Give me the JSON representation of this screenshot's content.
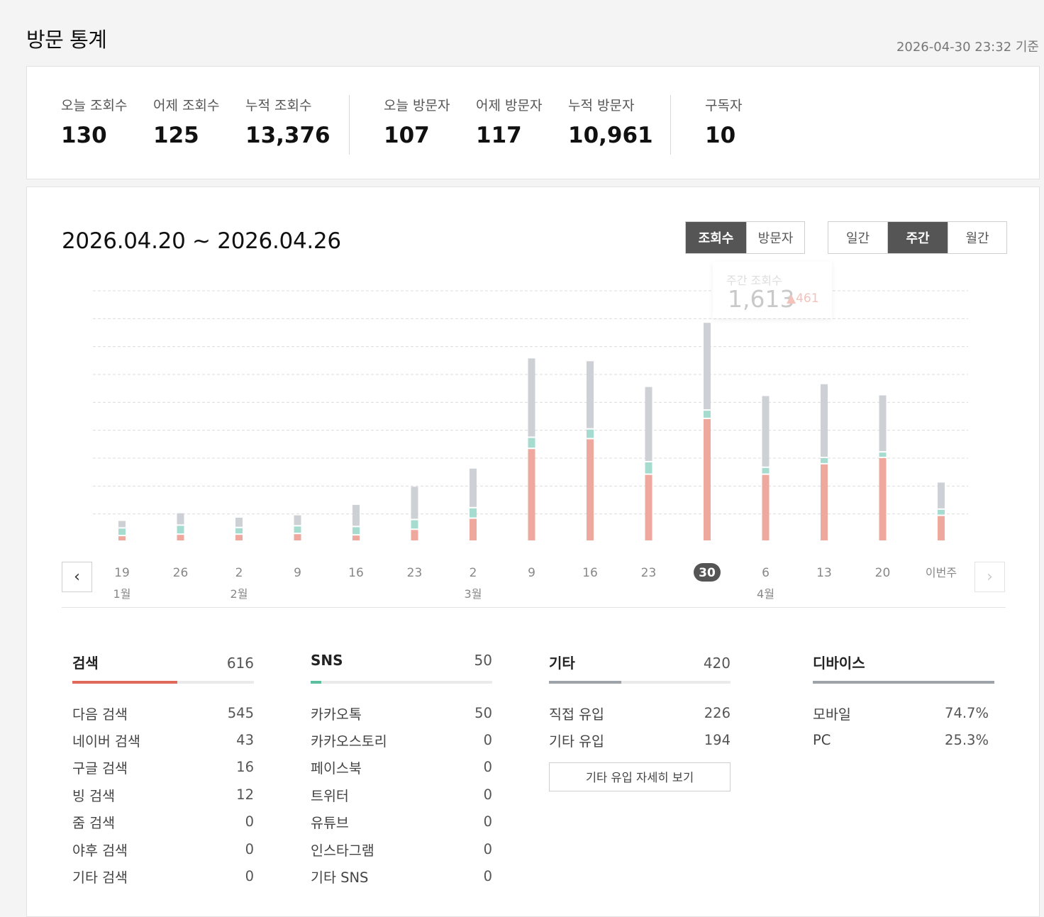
{
  "header": {
    "title": "방문 통계",
    "as_of": "2026-04-30 23:32 기준"
  },
  "summary": {
    "stats": [
      {
        "label": "오늘 조회수",
        "value": "130"
      },
      {
        "label": "어제 조회수",
        "value": "125"
      },
      {
        "label": "누적 조회수",
        "value": "13,376"
      },
      {
        "label": "오늘 방문자",
        "value": "107"
      },
      {
        "label": "어제 방문자",
        "value": "117"
      },
      {
        "label": "누적 방문자",
        "value": "10,961"
      },
      {
        "label": "구독자",
        "value": "10"
      }
    ]
  },
  "chart_panel": {
    "range_title": "2026.04.20 ~ 2026.04.26",
    "metric_toggle": [
      "조회수",
      "방문자"
    ],
    "metric_selected": "조회수",
    "period_toggle": [
      "일간",
      "주간",
      "월간"
    ],
    "period_selected": "주간",
    "tooltip": {
      "label": "주간 조회수",
      "value": "1,613",
      "delta": "▲461"
    },
    "prev_icon": "chevron-left-icon",
    "next_icon": "chevron-right-icon"
  },
  "chart_data": {
    "type": "bar",
    "stacked": true,
    "categories": [
      "19",
      "26",
      "2",
      "9",
      "16",
      "23",
      "2",
      "9",
      "16",
      "23",
      "30",
      "6",
      "13",
      "20",
      "이번주"
    ],
    "month_labels": [
      "1월",
      "",
      "2월",
      "",
      "",
      "",
      "3월",
      "",
      "",
      "",
      "",
      "4월",
      "",
      "",
      ""
    ],
    "selected_category_index": 10,
    "ylim": [
      0,
      1800
    ],
    "grid": true,
    "series": [
      {
        "color": "#eea89e",
        "values": [
          40,
          50,
          50,
          55,
          45,
          85,
          165,
          665,
          735,
          480,
          880,
          480,
          555,
          600,
          185
        ]
      },
      {
        "color": "#a6dccf",
        "values": [
          55,
          65,
          48,
          55,
          60,
          70,
          75,
          80,
          70,
          90,
          60,
          50,
          45,
          40,
          45
        ]
      },
      {
        "color": "#cdd0d5",
        "values": [
          55,
          90,
          75,
          80,
          160,
          240,
          285,
          570,
          490,
          540,
          630,
          515,
          530,
          410,
          195
        ]
      }
    ]
  },
  "breakdown": {
    "search": {
      "title": "검색",
      "total": "616",
      "fill": 0.58,
      "color": "#e06a5a",
      "rows": [
        {
          "label": "다음 검색",
          "value": "545"
        },
        {
          "label": "네이버 검색",
          "value": "43"
        },
        {
          "label": "구글 검색",
          "value": "16"
        },
        {
          "label": "빙 검색",
          "value": "12"
        },
        {
          "label": "줌 검색",
          "value": "0"
        },
        {
          "label": "야후 검색",
          "value": "0"
        },
        {
          "label": "기타 검색",
          "value": "0"
        }
      ]
    },
    "sns": {
      "title": "SNS",
      "total": "50",
      "fill": 0.06,
      "color": "#5bbf9f",
      "rows": [
        {
          "label": "카카오톡",
          "value": "50"
        },
        {
          "label": "카카오스토리",
          "value": "0"
        },
        {
          "label": "페이스북",
          "value": "0"
        },
        {
          "label": "트위터",
          "value": "0"
        },
        {
          "label": "유튜브",
          "value": "0"
        },
        {
          "label": "인스타그램",
          "value": "0"
        },
        {
          "label": "기타 SNS",
          "value": "0"
        }
      ]
    },
    "other": {
      "title": "기타",
      "total": "420",
      "fill": 0.4,
      "color": "#9ea3aa",
      "rows": [
        {
          "label": "직접 유입",
          "value": "226"
        },
        {
          "label": "기타 유입",
          "value": "194"
        }
      ],
      "detail_button": "기타 유입 자세히 보기"
    },
    "device": {
      "title": "디바이스",
      "fill": 1.0,
      "color": "#9ea3aa",
      "rows": [
        {
          "label": "모바일",
          "value": "74.7%"
        },
        {
          "label": "PC",
          "value": "25.3%"
        }
      ]
    }
  }
}
